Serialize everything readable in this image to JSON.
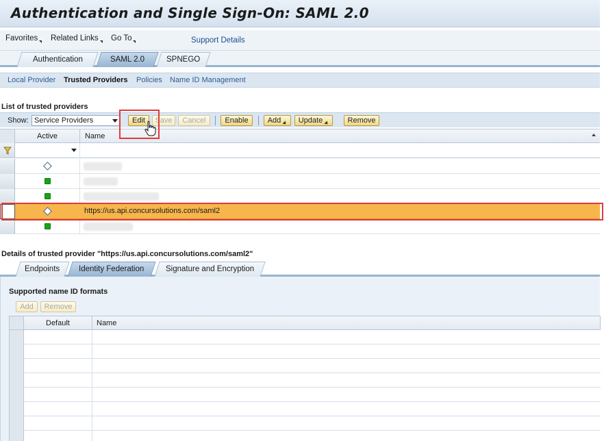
{
  "page": {
    "title": "Authentication and Single Sign-On: SAML 2.0"
  },
  "menu": {
    "favorites": "Favorites",
    "related_links": "Related Links",
    "go_to": "Go To",
    "support_details": "Support Details"
  },
  "top_tabs": [
    "Authentication",
    "SAML 2.0",
    "SPNEGO"
  ],
  "subnav": [
    "Local Provider",
    "Trusted Providers",
    "Policies",
    "Name ID Management"
  ],
  "list": {
    "heading": "List of trusted providers",
    "show_label": "Show:",
    "show_value": "Service Providers",
    "buttons": {
      "edit": "Edit",
      "save": "Save",
      "cancel": "Cancel",
      "enable": "Enable",
      "add": "Add",
      "update": "Update",
      "remove": "Remove"
    },
    "columns": [
      "Active",
      "Name"
    ],
    "selected_name": "https://us.api.concursolutions.com/saml2"
  },
  "details": {
    "heading": "Details of trusted provider \"https://us.api.concursolutions.com/saml2\"",
    "tabs": [
      "Endpoints",
      "Identity Federation",
      "Signature and Encryption"
    ],
    "name_id": {
      "heading": "Supported name ID formats",
      "add": "Add",
      "remove": "Remove",
      "columns": [
        "Default",
        "Name"
      ]
    }
  },
  "colors": {
    "selected_row": "#f6b64b",
    "active_green": "#1aa31a",
    "highlight_red": "#e03a3a",
    "link_blue": "#2b5c93"
  }
}
